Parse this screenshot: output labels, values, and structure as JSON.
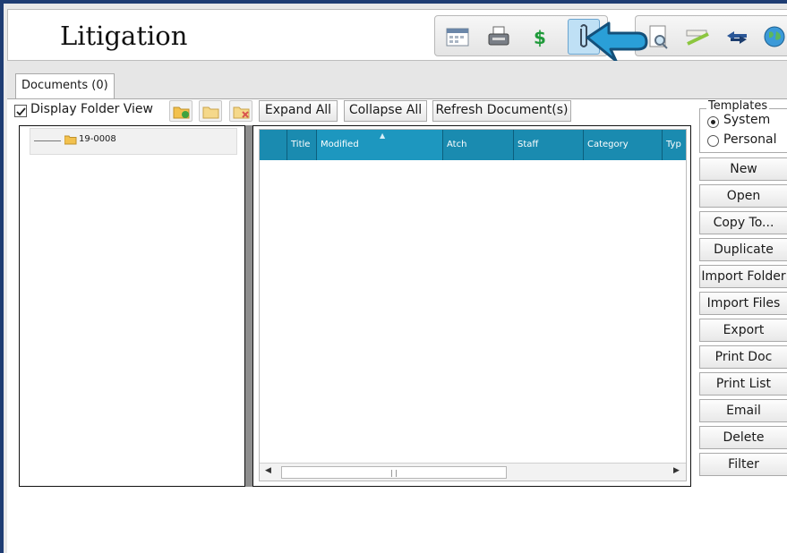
{
  "app": {
    "title": "Litigation"
  },
  "toolbar": {
    "group1": [
      {
        "icon": "calendar-icon",
        "active": false
      },
      {
        "icon": "fax-icon",
        "active": false
      },
      {
        "icon": "dollar-icon",
        "active": false
      },
      {
        "icon": "paperclip-icon",
        "active": true
      }
    ],
    "group2": [
      {
        "icon": "magnifier-document-icon"
      },
      {
        "icon": "ruler-pencil-icon"
      },
      {
        "icon": "arrows-icon"
      },
      {
        "icon": "globe-icon"
      }
    ],
    "pointer": "blue-arrow-icon"
  },
  "tabs": [
    {
      "label": "Documents (0)",
      "active": true
    }
  ],
  "documents": {
    "display_folder_view_label": "Display Folder View",
    "display_folder_view_checked": true,
    "folder_buttons": [
      "new-folder-icon",
      "open-folder-icon",
      "delete-folder-icon"
    ],
    "expand_all": "Expand All",
    "collapse_all": "Collapse All",
    "refresh": "Refresh Document(s)",
    "tree": {
      "root": "19-0008"
    },
    "grid": {
      "columns": [
        "",
        "Title",
        "Modified",
        "Atch",
        "Staff",
        "Category",
        "Typ"
      ],
      "sorted_column": "Modified",
      "rows": []
    }
  },
  "templates": {
    "legend": "Templates",
    "options": [
      {
        "label": "System",
        "selected": true
      },
      {
        "label": "Personal",
        "selected": false
      }
    ]
  },
  "actions": [
    "New",
    "Open",
    "Copy To...",
    "Duplicate",
    "Import Folder",
    "Import Files",
    "Export",
    "Print Doc",
    "Print List",
    "Email",
    "Delete",
    "Filter"
  ],
  "colors": {
    "grid_header": "#1a8bb0",
    "frame": "#1f3d73",
    "pointer": "#2a9fd8"
  }
}
